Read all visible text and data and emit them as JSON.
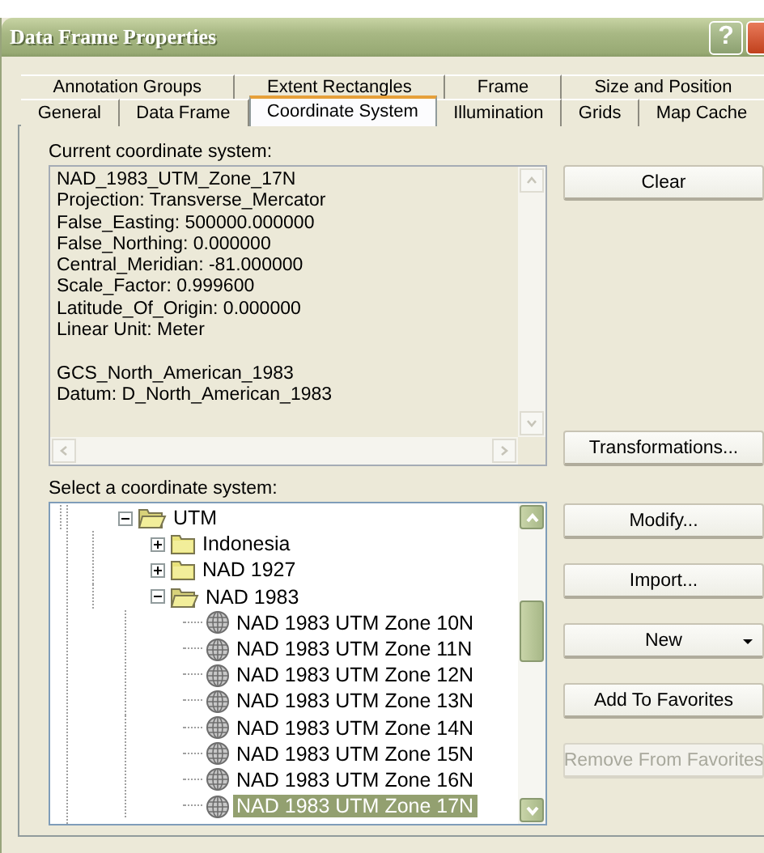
{
  "window": {
    "title": "Data Frame Properties",
    "help": "?"
  },
  "tab_rows": [
    [
      {
        "label": "Annotation Groups",
        "selected": false
      },
      {
        "label": "Extent Rectangles",
        "selected": false
      },
      {
        "label": "Frame",
        "selected": false
      },
      {
        "label": "Size and Position",
        "selected": false
      }
    ],
    [
      {
        "label": "General",
        "selected": false
      },
      {
        "label": "Data Frame",
        "selected": false
      },
      {
        "label": "Coordinate System",
        "selected": true
      },
      {
        "label": "Illumination",
        "selected": false
      },
      {
        "label": "Grids",
        "selected": false
      },
      {
        "label": "Map Cache",
        "selected": false
      }
    ]
  ],
  "current": {
    "label": "Current coordinate system:",
    "blocks": [
      [
        "NAD_1983_UTM_Zone_17N",
        "Projection: Transverse_Mercator",
        "False_Easting: 500000.000000",
        "False_Northing: 0.000000",
        "Central_Meridian: -81.000000",
        "Scale_Factor: 0.999600",
        "Latitude_Of_Origin: 0.000000",
        "Linear Unit: Meter"
      ],
      [
        "GCS_North_American_1983",
        "Datum: D_North_American_1983"
      ]
    ]
  },
  "current_buttons": [
    {
      "label": "Clear",
      "disabled": false,
      "kind": "plain"
    },
    {
      "label": "Transformations...",
      "disabled": false,
      "kind": "plain"
    }
  ],
  "select": {
    "label": "Select a coordinate system:",
    "tree": [
      {
        "label": "UTM",
        "kind": "folder",
        "expanded": true,
        "selected": false,
        "children": [
          {
            "label": "Indonesia",
            "kind": "folder",
            "expanded": false,
            "selected": false
          },
          {
            "label": "NAD 1927",
            "kind": "folder",
            "expanded": false,
            "selected": false
          },
          {
            "label": "NAD 1983",
            "kind": "folder",
            "expanded": true,
            "selected": false,
            "children": [
              {
                "label": "NAD 1983 UTM Zone 10N",
                "kind": "projection",
                "selected": false
              },
              {
                "label": "NAD 1983 UTM Zone 11N",
                "kind": "projection",
                "selected": false
              },
              {
                "label": "NAD 1983 UTM Zone 12N",
                "kind": "projection",
                "selected": false
              },
              {
                "label": "NAD 1983 UTM Zone 13N",
                "kind": "projection",
                "selected": false
              },
              {
                "label": "NAD 1983 UTM Zone 14N",
                "kind": "projection",
                "selected": false
              },
              {
                "label": "NAD 1983 UTM Zone 15N",
                "kind": "projection",
                "selected": false
              },
              {
                "label": "NAD 1983 UTM Zone 16N",
                "kind": "projection",
                "selected": false
              },
              {
                "label": "NAD 1983 UTM Zone 17N",
                "kind": "projection",
                "selected": true
              }
            ]
          }
        ]
      }
    ]
  },
  "select_buttons": [
    {
      "label": "Modify...",
      "disabled": false,
      "kind": "plain"
    },
    {
      "label": "Import...",
      "disabled": false,
      "kind": "plain"
    },
    {
      "label": "New",
      "disabled": false,
      "kind": "dropdown"
    },
    {
      "label": "Add To Favorites",
      "disabled": false,
      "kind": "plain"
    },
    {
      "label": "Remove From Favorites",
      "disabled": true,
      "kind": "plain"
    }
  ]
}
